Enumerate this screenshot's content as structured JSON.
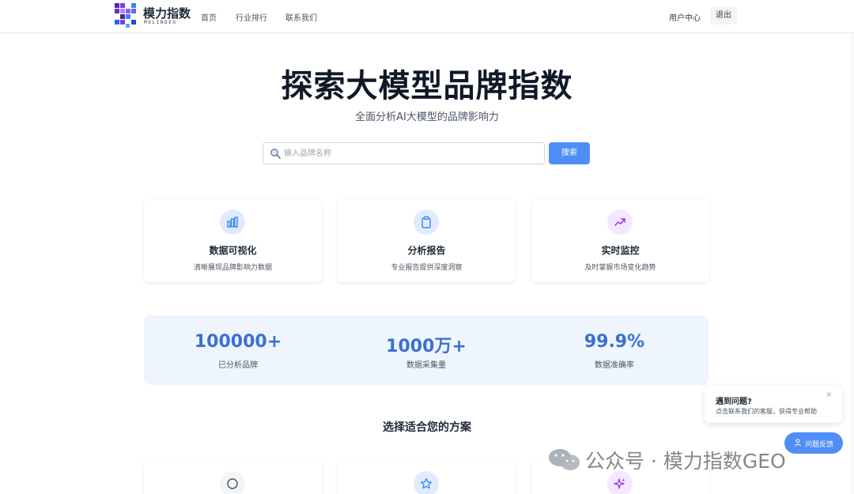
{
  "header": {
    "logo_text": "模力指数",
    "logo_sub": "MOLINDEX",
    "nav": [
      {
        "label": "首页"
      },
      {
        "label": "行业排行"
      },
      {
        "label": "联系我们"
      }
    ],
    "user_center": "用户中心",
    "logout": "退出"
  },
  "hero": {
    "title": "探索大模型品牌指数",
    "subtitle": "全面分析AI大模型的品牌影响力"
  },
  "search": {
    "placeholder": "输入品牌名称",
    "value": "",
    "button": "搜索"
  },
  "features": [
    {
      "title": "数据可视化",
      "desc": "清晰展现品牌影响力数据",
      "icon": "bar-chart-icon",
      "color": "#3b82f6"
    },
    {
      "title": "分析报告",
      "desc": "专业报告提供深度洞察",
      "icon": "clipboard-icon",
      "color": "#3b82f6"
    },
    {
      "title": "实时监控",
      "desc": "及时掌握市场变化趋势",
      "icon": "trending-up-icon",
      "color": "#9333ea"
    }
  ],
  "stats": [
    {
      "value": "100000+",
      "label": "已分析品牌"
    },
    {
      "value": "1000万+",
      "label": "数据采集量"
    },
    {
      "value": "99.9%",
      "label": "数据准确率"
    }
  ],
  "plans": {
    "title": "选择适合您的方案",
    "icons": [
      "circle-icon",
      "star-icon",
      "sparkle-icon"
    ]
  },
  "help": {
    "title": "遇到问题?",
    "desc": "点击联系我们的客服，获得专业帮助",
    "close": "×",
    "feedback": "问题反馈"
  },
  "watermark": {
    "text": "公众号 · 模力指数GEO"
  },
  "colors": {
    "primary": "#4f8ef7",
    "stat_blue": "#3b6fd4",
    "stats_bg": "#eff5fd"
  }
}
